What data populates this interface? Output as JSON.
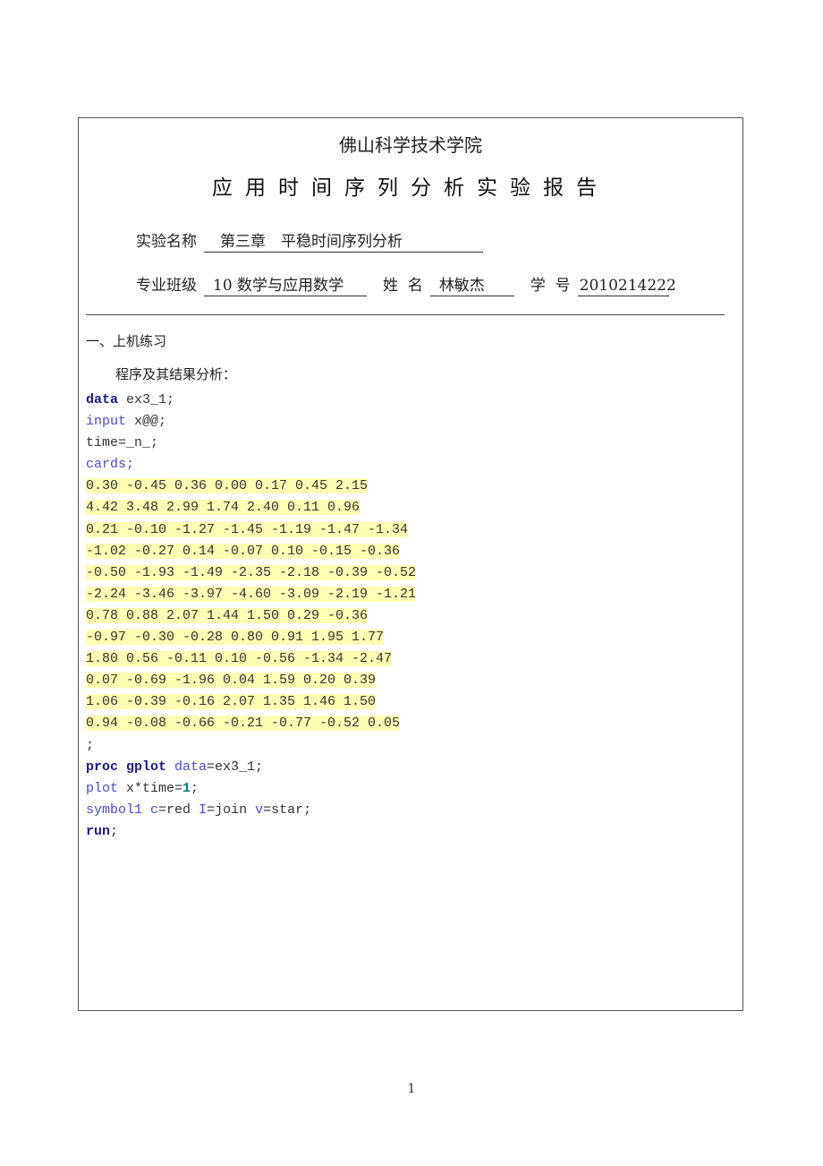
{
  "header": {
    "school": "佛山科学技术学院",
    "title": "应用时间序列分析实验报告"
  },
  "fields": {
    "experiment_label": "实验名称",
    "experiment_value": "第三章　平稳时间序列分析",
    "class_label": "专业班级",
    "class_value": "10 数学与应用数学",
    "name_label": "姓  名",
    "name_value": "林敏杰",
    "id_label": "学  号",
    "id_value": "2010214222"
  },
  "section": {
    "heading": "一、上机练习",
    "subheading": "程序及其结果分析："
  },
  "code": {
    "line1_kw": "data",
    "line1_rest": " ex3_1;",
    "line2_kw": "input",
    "line2_rest": " x@@;",
    "line3": "time=_n_;",
    "line4": "cards;",
    "data_lines": [
      "0.30 -0.45 0.36 0.00 0.17 0.45 2.15",
      "4.42 3.48 2.99 1.74 2.40 0.11 0.96",
      "0.21 -0.10 -1.27 -1.45 -1.19 -1.47 -1.34",
      "-1.02 -0.27 0.14 -0.07 0.10 -0.15 -0.36",
      "-0.50 -1.93 -1.49 -2.35 -2.18 -0.39 -0.52",
      "-2.24 -3.46 -3.97 -4.60 -3.09 -2.19 -1.21",
      "0.78 0.88 2.07 1.44 1.50 0.29 -0.36",
      "-0.97 -0.30 -0.28 0.80 0.91 1.95 1.77",
      "1.80 0.56 -0.11 0.10 -0.56 -1.34 -2.47",
      "0.07 -0.69 -1.96 0.04 1.59 0.20 0.39",
      "1.06 -0.39 -0.16 2.07 1.35 1.46 1.50",
      "0.94 -0.08 -0.66 -0.21 -0.77 -0.52 0.05"
    ],
    "terminator": ";",
    "proc_kw": "proc gplot",
    "proc_opt": " data",
    "proc_rest": "=ex3_1;",
    "plot_kw": "plot",
    "plot_rest": " x*time=",
    "plot_num": "1",
    "plot_end": ";",
    "symbol_kw": "symbol1",
    "symbol_c": " c",
    "symbol_c_val": "=red ",
    "symbol_i": "I",
    "symbol_i_val": "=join ",
    "symbol_v": "v",
    "symbol_v_val": "=star;",
    "run_kw": "run",
    "run_end": ";"
  },
  "footer": {
    "page_number": "1"
  },
  "colors": {
    "keyword": "#1a1a80",
    "option": "#4a4adf",
    "number": "#0a7a7a",
    "highlight": "#ffffb3"
  }
}
